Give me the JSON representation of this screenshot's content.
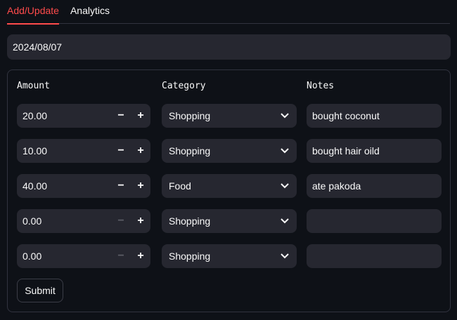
{
  "tabs": [
    {
      "label": "Add/Update",
      "active": true
    },
    {
      "label": "Analytics",
      "active": false
    }
  ],
  "date": "2024/08/07",
  "columns": {
    "amount": "Amount",
    "category": "Category",
    "notes": "Notes"
  },
  "rows": [
    {
      "amount": "20.00",
      "category": "Shopping",
      "notes": "bought coconut",
      "minus_disabled": false
    },
    {
      "amount": "10.00",
      "category": "Shopping",
      "notes": "bought hair oild",
      "minus_disabled": false
    },
    {
      "amount": "40.00",
      "category": "Food",
      "notes": "ate pakoda",
      "minus_disabled": false
    },
    {
      "amount": "0.00",
      "category": "Shopping",
      "notes": "",
      "minus_disabled": true
    },
    {
      "amount": "0.00",
      "category": "Shopping",
      "notes": "",
      "minus_disabled": true
    }
  ],
  "stepper": {
    "minus": "−",
    "plus": "+"
  },
  "submit_label": "Submit",
  "colors": {
    "accent": "#ff4b4b",
    "background": "#0e1117",
    "field": "#262730"
  },
  "icons": {
    "select": "chevron-down-icon"
  }
}
